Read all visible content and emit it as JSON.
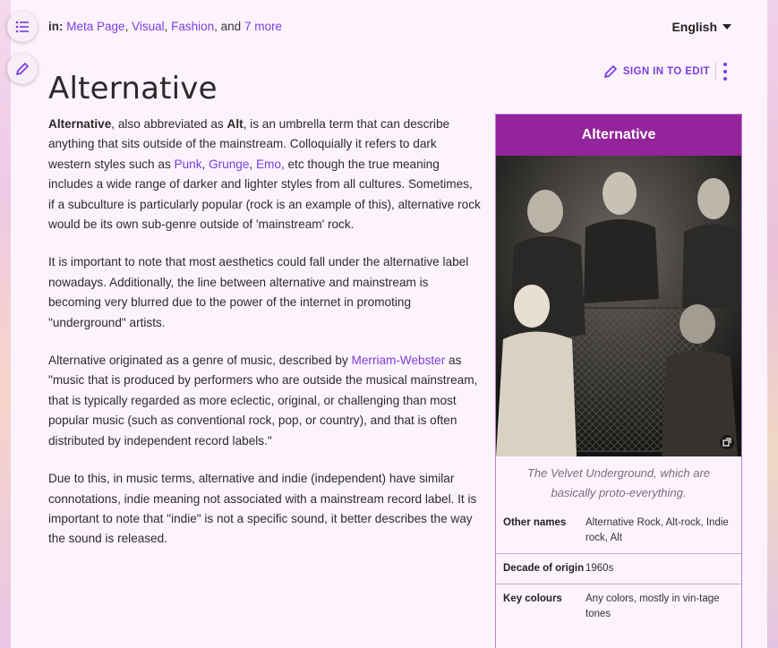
{
  "breadcrumb": {
    "prefix": "in:",
    "cat1": "Meta Page",
    "cat2": "Visual",
    "cat3": "Fashion",
    "and_text": ", and",
    "more": "7 more"
  },
  "language": "English",
  "title": "Alternative",
  "edit_label": "SIGN IN TO EDIT",
  "article": {
    "p1": {
      "bold1": "Alternative",
      "t1": ", also abbreviated as ",
      "bold2": "Alt",
      "t2": ", is an umbrella term that can describe anything that sits outside of the mainstream. Colloquially it refers to dark western styles such as ",
      "link1": "Punk",
      "link2": "Grunge",
      "link3": "Emo",
      "t3": ", etc though the true meaning includes a wide range of darker and lighter styles from all cultures. Sometimes, if a subculture is particularly popular (rock is an example of this), alternative rock would be its own sub-genre outside of 'mainstream' rock."
    },
    "p2": "It is important to note that most aesthetics could fall under the alternative label nowadays. Additionally, the line between alternative and mainstream is becoming very blurred due to the power of the internet in promoting \"underground\" artists.",
    "p3": {
      "t1": "Alternative originated as a genre of music, described by ",
      "link": "Merriam-Webster",
      "t2": " as \"music that is produced by performers who are outside the musical mainstream, that is typically regarded as more eclectic, original, or challenging than most popular music (such as conventional rock, pop, or country), and that is often distributed by independent record labels.\""
    },
    "p4": "Due to this, in music terms, alternative and indie (independent) have similar connotations, indie meaning not associated with a mainstream record label. It is important to note that \"indie\" is not a specific sound, it better describes the way the sound is released."
  },
  "infobox": {
    "title": "Alternative",
    "caption": "The Velvet Underground, which are basically proto-everything.",
    "rows": [
      {
        "label": "Other names",
        "value": "Alternative Rock, Alt-rock, Indie rock, Alt"
      },
      {
        "label": "Decade of origin",
        "value": "1960s"
      },
      {
        "label": "Key colours",
        "value": "Any colors, mostly in vin-tage tones"
      }
    ]
  },
  "colors": {
    "accent": "#7a3ee0",
    "infobox_header": "#94249b",
    "page_bg": "#fdf3fc"
  }
}
